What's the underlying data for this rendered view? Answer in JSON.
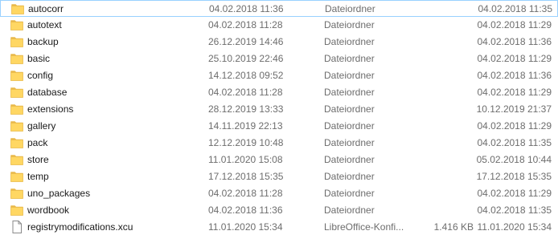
{
  "files": [
    {
      "name": "autocorr",
      "modified": "04.02.2018 11:36",
      "type": "Dateiordner",
      "size": "",
      "date2": "04.02.2018 11:35",
      "icon": "folder-icon",
      "selected": true
    },
    {
      "name": "autotext",
      "modified": "04.02.2018 11:28",
      "type": "Dateiordner",
      "size": "",
      "date2": "04.02.2018 11:29",
      "icon": "folder-icon"
    },
    {
      "name": "backup",
      "modified": "26.12.2019 14:46",
      "type": "Dateiordner",
      "size": "",
      "date2": "04.02.2018 11:36",
      "icon": "folder-icon"
    },
    {
      "name": "basic",
      "modified": "25.10.2019 22:46",
      "type": "Dateiordner",
      "size": "",
      "date2": "04.02.2018 11:29",
      "icon": "folder-icon"
    },
    {
      "name": "config",
      "modified": "14.12.2018 09:52",
      "type": "Dateiordner",
      "size": "",
      "date2": "04.02.2018 11:36",
      "icon": "folder-icon"
    },
    {
      "name": "database",
      "modified": "04.02.2018 11:28",
      "type": "Dateiordner",
      "size": "",
      "date2": "04.02.2018 11:29",
      "icon": "folder-icon"
    },
    {
      "name": "extensions",
      "modified": "28.12.2019 13:33",
      "type": "Dateiordner",
      "size": "",
      "date2": "10.12.2019 21:37",
      "icon": "folder-icon"
    },
    {
      "name": "gallery",
      "modified": "14.11.2019 22:13",
      "type": "Dateiordner",
      "size": "",
      "date2": "04.02.2018 11:29",
      "icon": "folder-icon"
    },
    {
      "name": "pack",
      "modified": "12.12.2019 10:48",
      "type": "Dateiordner",
      "size": "",
      "date2": "04.02.2018 11:35",
      "icon": "folder-icon"
    },
    {
      "name": "store",
      "modified": "11.01.2020 15:08",
      "type": "Dateiordner",
      "size": "",
      "date2": "05.02.2018 10:44",
      "icon": "folder-icon"
    },
    {
      "name": "temp",
      "modified": "17.12.2018 15:35",
      "type": "Dateiordner",
      "size": "",
      "date2": "17.12.2018 15:35",
      "icon": "folder-icon"
    },
    {
      "name": "uno_packages",
      "modified": "04.02.2018 11:28",
      "type": "Dateiordner",
      "size": "",
      "date2": "04.02.2018 11:29",
      "icon": "folder-icon"
    },
    {
      "name": "wordbook",
      "modified": "04.02.2018 11:36",
      "type": "Dateiordner",
      "size": "",
      "date2": "04.02.2018 11:35",
      "icon": "folder-icon"
    },
    {
      "name": "registrymodifications.xcu",
      "modified": "11.01.2020 15:34",
      "type": "LibreOffice-Konfi...",
      "size": "1.416 KB",
      "date2": "11.01.2020 15:34",
      "icon": "document-icon"
    }
  ],
  "colors": {
    "folder_fill": "#ffd763",
    "folder_dark": "#e8b84a",
    "selection_border": "#99d1ff"
  }
}
